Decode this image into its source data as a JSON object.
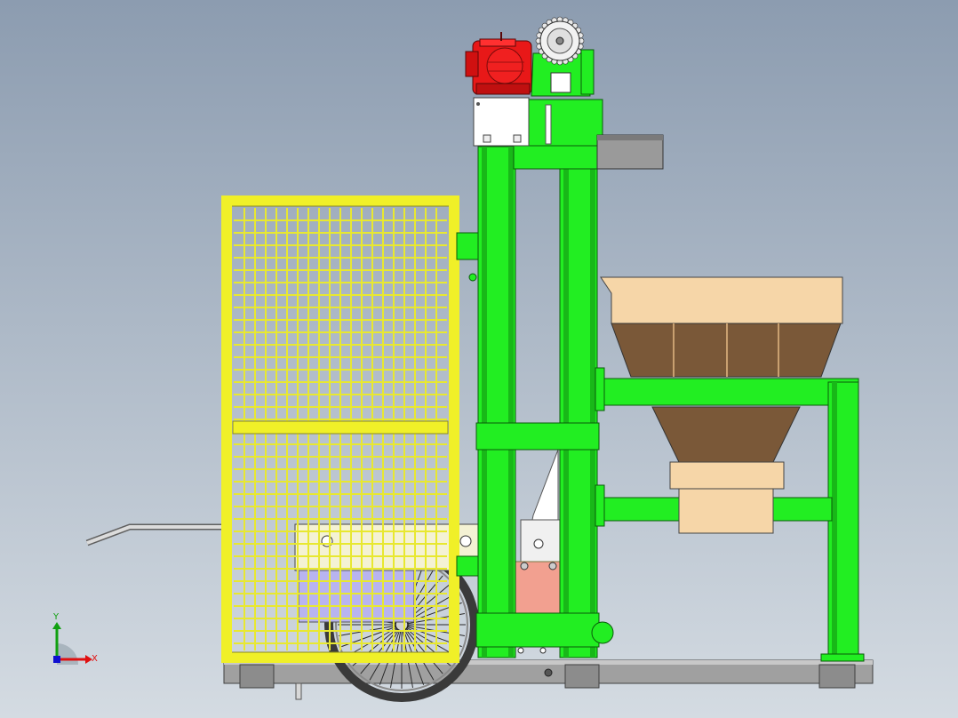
{
  "triad": {
    "x_label": "X",
    "y_label": "Y",
    "x_color": "#e01010",
    "y_color": "#10a010",
    "z_color": "#1010d0"
  },
  "colors": {
    "background_top": "#8c9cb0",
    "background_bottom": "#d4dbe2",
    "frame_green": "#22ee22",
    "motor_red": "#e81818",
    "cage_yellow": "#f0f028",
    "hopper_tan": "#f6d6a8",
    "hopper_brown": "#7a5838",
    "plate_pink": "#f2a090",
    "base_gray": "#9a9a9a"
  },
  "parts": [
    "motor-icon",
    "sprocket-icon",
    "mast-frame",
    "chute",
    "safety-cage",
    "hopper",
    "support-frame",
    "wheel-icon",
    "handle-bar",
    "lift-plate",
    "base-frame"
  ]
}
